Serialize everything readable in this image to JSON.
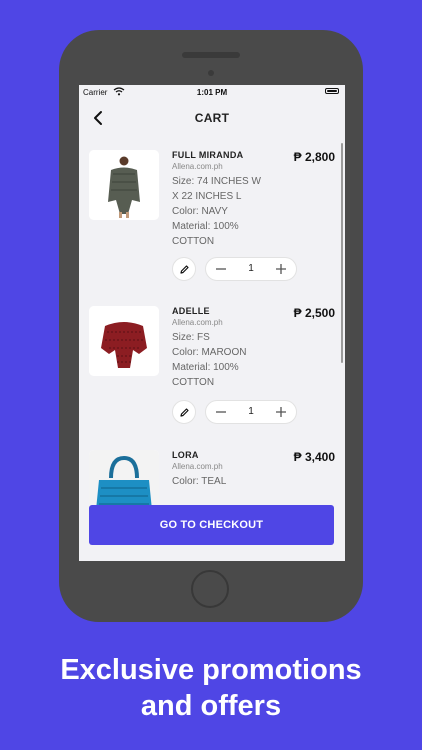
{
  "status": {
    "carrier": "Carrier",
    "time": "1:01 PM"
  },
  "nav": {
    "title": "CART"
  },
  "items": [
    {
      "name": "FULL MIRANDA",
      "store": "Allena.com.ph",
      "price": "₱ 2,800",
      "details": [
        "Size: 74 INCHES W",
        "X 22 INCHES L",
        "Color: NAVY",
        "Material: 100%",
        "COTTON"
      ],
      "quantity": "1"
    },
    {
      "name": "ADELLE",
      "store": "Allena.com.ph",
      "price": "₱ 2,500",
      "details": [
        "Size: FS",
        "Color: MAROON",
        "Material: 100%",
        "COTTON"
      ],
      "quantity": "1"
    },
    {
      "name": "LORA",
      "store": "Allena.com.ph",
      "price": "₱ 3,400",
      "details": [
        "Color: TEAL"
      ]
    }
  ],
  "checkout": {
    "label": "GO TO CHECKOUT"
  },
  "tagline": {
    "line1": "Exclusive promotions",
    "line2": "and offers"
  },
  "colors": {
    "brand": "#4f46e5",
    "screen_bg": "#f2f2f5"
  },
  "icons": {
    "back": "chevron-left-icon",
    "edit": "pencil-icon",
    "minus": "minus-icon",
    "plus": "plus-icon"
  }
}
